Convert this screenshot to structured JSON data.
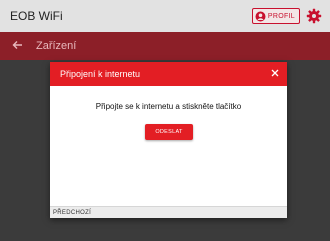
{
  "topbar": {
    "title": "EOB WiFi",
    "profile_label": "PROFIL",
    "profile_icon": "user-icon",
    "settings_icon": "gear-icon"
  },
  "navbar": {
    "back_icon": "arrow-left-icon",
    "title": "Zařízení"
  },
  "dialog": {
    "title": "Připojení k internetu",
    "close_icon": "close-icon",
    "message": "Připojte se k internetu a stiskněte tlačítko",
    "send_label": "ODESLAT",
    "prev_label": "PŘEDCHOZÍ"
  },
  "colors": {
    "accent": "#e31e24",
    "navbar": "#8c1f28",
    "topbar": "#e2e2e2",
    "overlay": "#3b3b3b"
  }
}
